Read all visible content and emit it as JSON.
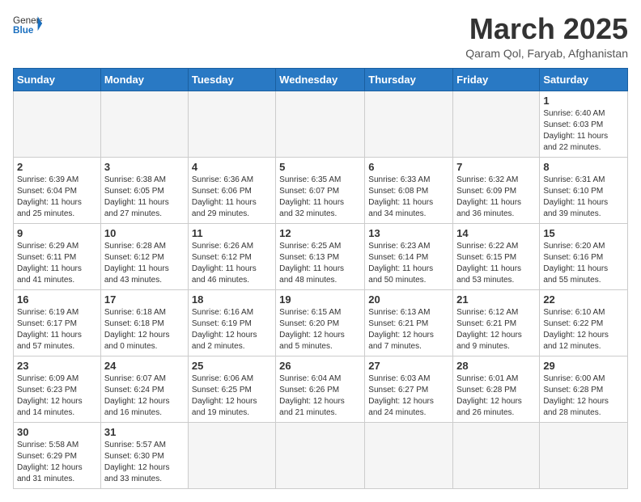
{
  "header": {
    "logo_general": "General",
    "logo_blue": "Blue",
    "month_year": "March 2025",
    "location": "Qaram Qol, Faryab, Afghanistan"
  },
  "weekdays": [
    "Sunday",
    "Monday",
    "Tuesday",
    "Wednesday",
    "Thursday",
    "Friday",
    "Saturday"
  ],
  "weeks": [
    [
      {
        "day": "",
        "info": ""
      },
      {
        "day": "",
        "info": ""
      },
      {
        "day": "",
        "info": ""
      },
      {
        "day": "",
        "info": ""
      },
      {
        "day": "",
        "info": ""
      },
      {
        "day": "",
        "info": ""
      },
      {
        "day": "1",
        "info": "Sunrise: 6:40 AM\nSunset: 6:03 PM\nDaylight: 11 hours\nand 22 minutes."
      }
    ],
    [
      {
        "day": "2",
        "info": "Sunrise: 6:39 AM\nSunset: 6:04 PM\nDaylight: 11 hours\nand 25 minutes."
      },
      {
        "day": "3",
        "info": "Sunrise: 6:38 AM\nSunset: 6:05 PM\nDaylight: 11 hours\nand 27 minutes."
      },
      {
        "day": "4",
        "info": "Sunrise: 6:36 AM\nSunset: 6:06 PM\nDaylight: 11 hours\nand 29 minutes."
      },
      {
        "day": "5",
        "info": "Sunrise: 6:35 AM\nSunset: 6:07 PM\nDaylight: 11 hours\nand 32 minutes."
      },
      {
        "day": "6",
        "info": "Sunrise: 6:33 AM\nSunset: 6:08 PM\nDaylight: 11 hours\nand 34 minutes."
      },
      {
        "day": "7",
        "info": "Sunrise: 6:32 AM\nSunset: 6:09 PM\nDaylight: 11 hours\nand 36 minutes."
      },
      {
        "day": "8",
        "info": "Sunrise: 6:31 AM\nSunset: 6:10 PM\nDaylight: 11 hours\nand 39 minutes."
      }
    ],
    [
      {
        "day": "9",
        "info": "Sunrise: 6:29 AM\nSunset: 6:11 PM\nDaylight: 11 hours\nand 41 minutes."
      },
      {
        "day": "10",
        "info": "Sunrise: 6:28 AM\nSunset: 6:12 PM\nDaylight: 11 hours\nand 43 minutes."
      },
      {
        "day": "11",
        "info": "Sunrise: 6:26 AM\nSunset: 6:12 PM\nDaylight: 11 hours\nand 46 minutes."
      },
      {
        "day": "12",
        "info": "Sunrise: 6:25 AM\nSunset: 6:13 PM\nDaylight: 11 hours\nand 48 minutes."
      },
      {
        "day": "13",
        "info": "Sunrise: 6:23 AM\nSunset: 6:14 PM\nDaylight: 11 hours\nand 50 minutes."
      },
      {
        "day": "14",
        "info": "Sunrise: 6:22 AM\nSunset: 6:15 PM\nDaylight: 11 hours\nand 53 minutes."
      },
      {
        "day": "15",
        "info": "Sunrise: 6:20 AM\nSunset: 6:16 PM\nDaylight: 11 hours\nand 55 minutes."
      }
    ],
    [
      {
        "day": "16",
        "info": "Sunrise: 6:19 AM\nSunset: 6:17 PM\nDaylight: 11 hours\nand 57 minutes."
      },
      {
        "day": "17",
        "info": "Sunrise: 6:18 AM\nSunset: 6:18 PM\nDaylight: 12 hours\nand 0 minutes."
      },
      {
        "day": "18",
        "info": "Sunrise: 6:16 AM\nSunset: 6:19 PM\nDaylight: 12 hours\nand 2 minutes."
      },
      {
        "day": "19",
        "info": "Sunrise: 6:15 AM\nSunset: 6:20 PM\nDaylight: 12 hours\nand 5 minutes."
      },
      {
        "day": "20",
        "info": "Sunrise: 6:13 AM\nSunset: 6:21 PM\nDaylight: 12 hours\nand 7 minutes."
      },
      {
        "day": "21",
        "info": "Sunrise: 6:12 AM\nSunset: 6:21 PM\nDaylight: 12 hours\nand 9 minutes."
      },
      {
        "day": "22",
        "info": "Sunrise: 6:10 AM\nSunset: 6:22 PM\nDaylight: 12 hours\nand 12 minutes."
      }
    ],
    [
      {
        "day": "23",
        "info": "Sunrise: 6:09 AM\nSunset: 6:23 PM\nDaylight: 12 hours\nand 14 minutes."
      },
      {
        "day": "24",
        "info": "Sunrise: 6:07 AM\nSunset: 6:24 PM\nDaylight: 12 hours\nand 16 minutes."
      },
      {
        "day": "25",
        "info": "Sunrise: 6:06 AM\nSunset: 6:25 PM\nDaylight: 12 hours\nand 19 minutes."
      },
      {
        "day": "26",
        "info": "Sunrise: 6:04 AM\nSunset: 6:26 PM\nDaylight: 12 hours\nand 21 minutes."
      },
      {
        "day": "27",
        "info": "Sunrise: 6:03 AM\nSunset: 6:27 PM\nDaylight: 12 hours\nand 24 minutes."
      },
      {
        "day": "28",
        "info": "Sunrise: 6:01 AM\nSunset: 6:28 PM\nDaylight: 12 hours\nand 26 minutes."
      },
      {
        "day": "29",
        "info": "Sunrise: 6:00 AM\nSunset: 6:28 PM\nDaylight: 12 hours\nand 28 minutes."
      }
    ],
    [
      {
        "day": "30",
        "info": "Sunrise: 5:58 AM\nSunset: 6:29 PM\nDaylight: 12 hours\nand 31 minutes."
      },
      {
        "day": "31",
        "info": "Sunrise: 5:57 AM\nSunset: 6:30 PM\nDaylight: 12 hours\nand 33 minutes."
      },
      {
        "day": "",
        "info": ""
      },
      {
        "day": "",
        "info": ""
      },
      {
        "day": "",
        "info": ""
      },
      {
        "day": "",
        "info": ""
      },
      {
        "day": "",
        "info": ""
      }
    ]
  ]
}
